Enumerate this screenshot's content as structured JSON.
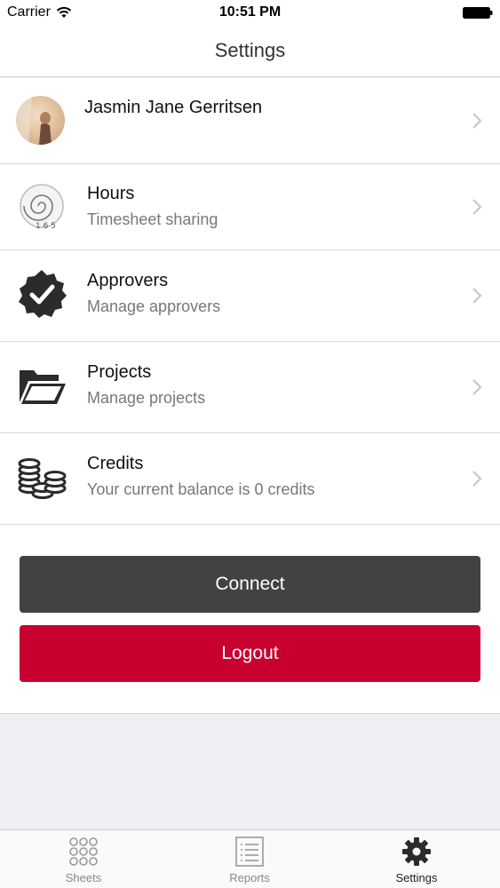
{
  "status_bar": {
    "carrier": "Carrier",
    "time": "10:51 PM"
  },
  "nav": {
    "title": "Settings"
  },
  "profile": {
    "name": "Jasmin Jane Gerritsen",
    "avatar_icon": "avatar-photo"
  },
  "menu": [
    {
      "title": "Hours",
      "subtitle": "Timesheet sharing",
      "icon": "clock-spiral-icon"
    },
    {
      "title": "Approvers",
      "subtitle": "Manage approvers",
      "icon": "check-badge-icon"
    },
    {
      "title": "Projects",
      "subtitle": "Manage projects",
      "icon": "folder-icon"
    },
    {
      "title": "Credits",
      "subtitle": "Your current balance is 0 credits",
      "icon": "coins-icon"
    }
  ],
  "buttons": {
    "connect": "Connect",
    "logout": "Logout"
  },
  "tabs": [
    {
      "label": "Sheets",
      "icon": "grid-dots-icon",
      "active": false
    },
    {
      "label": "Reports",
      "icon": "list-document-icon",
      "active": false
    },
    {
      "label": "Settings",
      "icon": "gear-icon",
      "active": true
    }
  ],
  "colors": {
    "connect_button": "#424144",
    "logout_button": "#c8002f",
    "accent": "#222222"
  }
}
